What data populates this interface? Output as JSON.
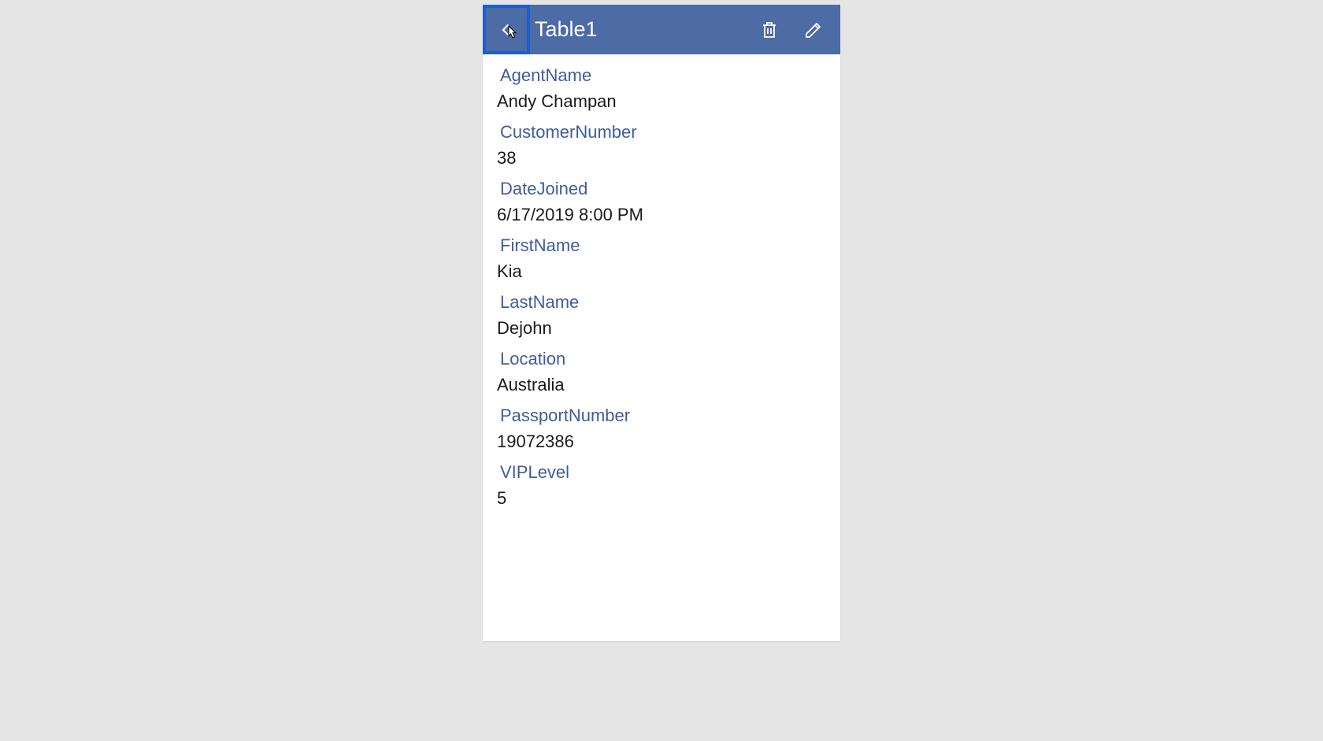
{
  "header": {
    "title": "Table1"
  },
  "fields": [
    {
      "label": "AgentName",
      "value": "Andy Champan"
    },
    {
      "label": "CustomerNumber",
      "value": "38"
    },
    {
      "label": "DateJoined",
      "value": "6/17/2019 8:00 PM"
    },
    {
      "label": "FirstName",
      "value": "Kia"
    },
    {
      "label": "LastName",
      "value": "Dejohn"
    },
    {
      "label": "Location",
      "value": "Australia"
    },
    {
      "label": "PassportNumber",
      "value": "19072386"
    },
    {
      "label": "VIPLevel",
      "value": "5"
    }
  ]
}
